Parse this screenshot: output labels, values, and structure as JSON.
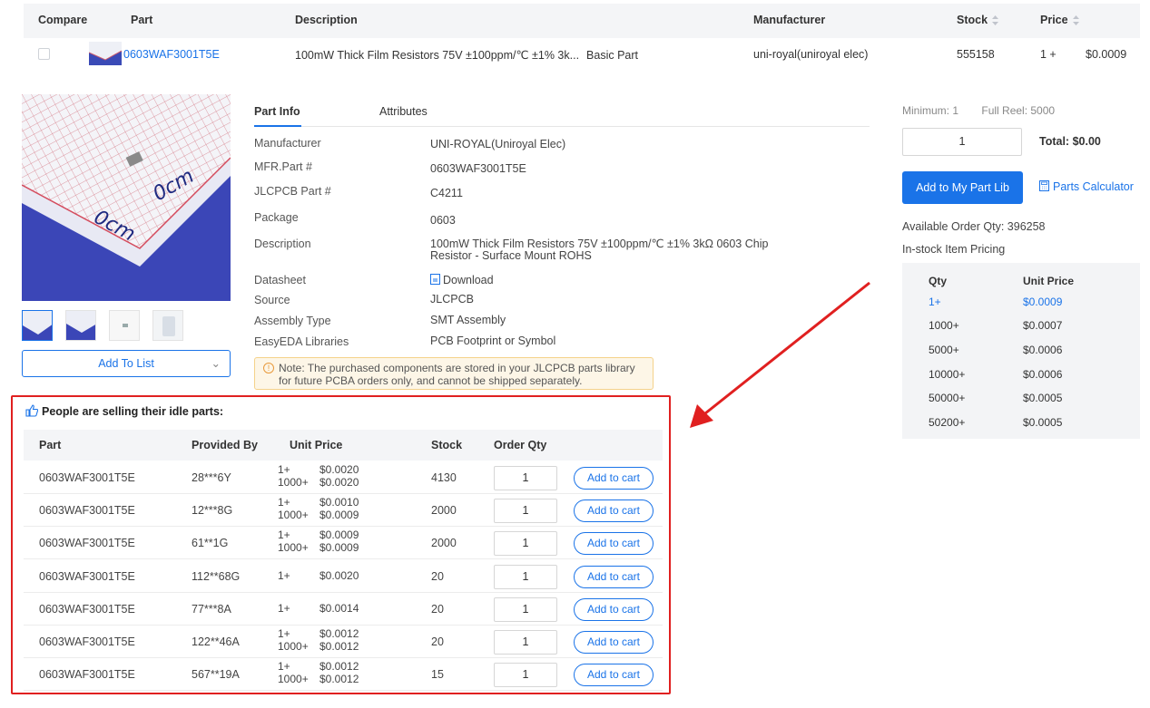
{
  "results_table": {
    "headers": {
      "compare": "Compare",
      "part": "Part",
      "description": "Description",
      "manufacturer": "Manufacturer",
      "stock": "Stock",
      "price": "Price"
    },
    "row": {
      "part": "0603WAF3001T5E",
      "description": "100mW Thick Film Resistors 75V ±100ppm/℃ ±1% 3k...",
      "tag": "Basic Part",
      "manufacturer": "uni-royal(uniroyal elec)",
      "stock": "555158",
      "price_qty": "1 +",
      "price": "$0.0009"
    }
  },
  "gallery": {
    "add_to_list": "Add To List"
  },
  "part_info": {
    "tabs": [
      "Part Info",
      "Attributes"
    ],
    "rows": [
      {
        "label": "Manufacturer",
        "value": "UNI-ROYAL(Uniroyal Elec)"
      },
      {
        "label": "MFR.Part #",
        "value": "0603WAF3001T5E"
      },
      {
        "label": "JLCPCB Part #",
        "value": "C4211"
      },
      {
        "label": "Package",
        "value": "0603"
      },
      {
        "label": "Description",
        "value": "100mW Thick Film Resistors 75V ±100ppm/℃ ±1% 3kΩ 0603 Chip Resistor - Surface Mount ROHS"
      },
      {
        "label": "Datasheet",
        "value": "Download"
      },
      {
        "label": "Source",
        "value": "JLCPCB"
      },
      {
        "label": "Assembly Type",
        "value": "SMT Assembly"
      },
      {
        "label": "EasyEDA Libraries",
        "value": "PCB Footprint or Symbol"
      }
    ],
    "note": "Note: The purchased components are stored in your JLCPCB parts library for future PCBA orders only, and cannot be shipped separately."
  },
  "purchase": {
    "minimum": "Minimum: 1",
    "full_reel": "Full Reel: 5000",
    "qty_value": "1",
    "total": "Total: $0.00",
    "add_lib_button": "Add to My Part Lib",
    "calculator": "Parts Calculator",
    "available": "Available Order Qty: 396258",
    "instock_title": "In-stock Item Pricing",
    "pricing_headers": {
      "qty": "Qty",
      "price": "Unit Price"
    },
    "pricing": [
      {
        "qty": "1+",
        "price": "$0.0009"
      },
      {
        "qty": "1000+",
        "price": "$0.0007"
      },
      {
        "qty": "5000+",
        "price": "$0.0006"
      },
      {
        "qty": "10000+",
        "price": "$0.0006"
      },
      {
        "qty": "50000+",
        "price": "$0.0005"
      },
      {
        "qty": "50200+",
        "price": "$0.0005"
      }
    ]
  },
  "idle_parts": {
    "title": "People are selling their idle parts:",
    "headers": {
      "part": "Part",
      "provided_by": "Provided By",
      "unit_price": "Unit Price",
      "stock": "Stock",
      "order_qty": "Order Qty"
    },
    "cart_label": "Add to cart",
    "rows": [
      {
        "part": "0603WAF3001T5E",
        "by": "28***6Y",
        "tiers": [
          [
            "1+",
            "$0.0020"
          ],
          [
            "1000+",
            "$0.0020"
          ]
        ],
        "stock": "4130",
        "qty": "1"
      },
      {
        "part": "0603WAF3001T5E",
        "by": "12***8G",
        "tiers": [
          [
            "1+",
            "$0.0010"
          ],
          [
            "1000+",
            "$0.0009"
          ]
        ],
        "stock": "2000",
        "qty": "1"
      },
      {
        "part": "0603WAF3001T5E",
        "by": "61**1G",
        "tiers": [
          [
            "1+",
            "$0.0009"
          ],
          [
            "1000+",
            "$0.0009"
          ]
        ],
        "stock": "2000",
        "qty": "1"
      },
      {
        "part": "0603WAF3001T5E",
        "by": "112**68G",
        "tiers": [
          [
            "1+",
            "$0.0020"
          ]
        ],
        "stock": "20",
        "qty": "1"
      },
      {
        "part": "0603WAF3001T5E",
        "by": "77***8A",
        "tiers": [
          [
            "1+",
            "$0.0014"
          ]
        ],
        "stock": "20",
        "qty": "1"
      },
      {
        "part": "0603WAF3001T5E",
        "by": "122**46A",
        "tiers": [
          [
            "1+",
            "$0.0012"
          ],
          [
            "1000+",
            "$0.0012"
          ]
        ],
        "stock": "20",
        "qty": "1"
      },
      {
        "part": "0603WAF3001T5E",
        "by": "567**19A",
        "tiers": [
          [
            "1+",
            "$0.0012"
          ],
          [
            "1000+",
            "$0.0012"
          ]
        ],
        "stock": "15",
        "qty": "1"
      }
    ]
  },
  "colors": {
    "accent": "#1a73e8",
    "highlight_border": "#e02020",
    "note_bg": "#fdf6e7"
  }
}
